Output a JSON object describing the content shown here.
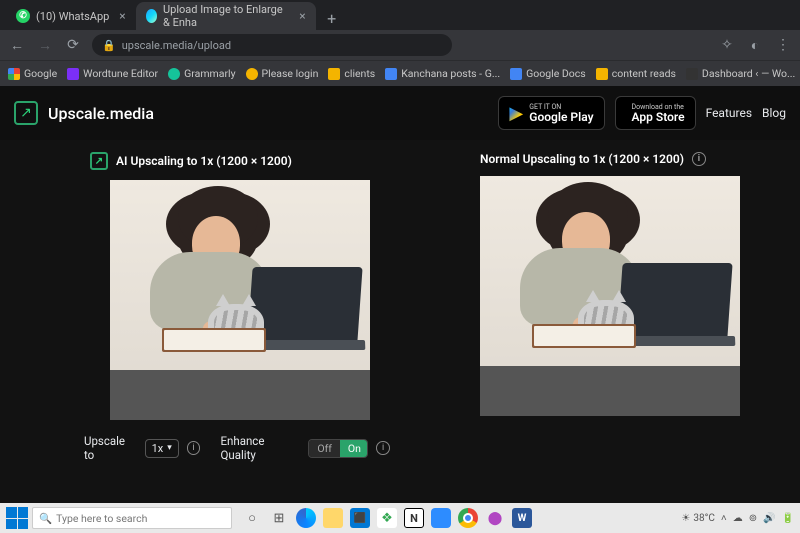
{
  "browser": {
    "tabs": [
      {
        "title": "(10) WhatsApp"
      },
      {
        "title": "Upload Image to Enlarge & Enha"
      }
    ],
    "url": "upscale.media/upload"
  },
  "bookmarks": [
    {
      "label": "Google"
    },
    {
      "label": "Wordtune Editor"
    },
    {
      "label": "Grammarly"
    },
    {
      "label": "Please login"
    },
    {
      "label": "clients"
    },
    {
      "label": "Kanchana posts - G..."
    },
    {
      "label": "Google Docs"
    },
    {
      "label": "content reads"
    },
    {
      "label": "Dashboard ‹ — Wo..."
    }
  ],
  "brand": "Upscale.media",
  "store_badges": {
    "google": {
      "tiny": "GET IT ON",
      "big": "Google Play"
    },
    "apple": {
      "tiny": "Download on the",
      "big": "App Store"
    }
  },
  "header_links": {
    "features": "Features",
    "blog": "Blog"
  },
  "panels": {
    "left_title": "AI Upscaling to 1x (1200 × 1200)",
    "right_title": "Normal Upscaling to 1x (1200 × 1200)"
  },
  "controls": {
    "upscale_label": "Upscale to",
    "upscale_value": "1x",
    "enhance_label": "Enhance Quality",
    "off": "Off",
    "on": "On"
  },
  "taskbar": {
    "search_placeholder": "Type here to search",
    "weather": "38°C"
  }
}
